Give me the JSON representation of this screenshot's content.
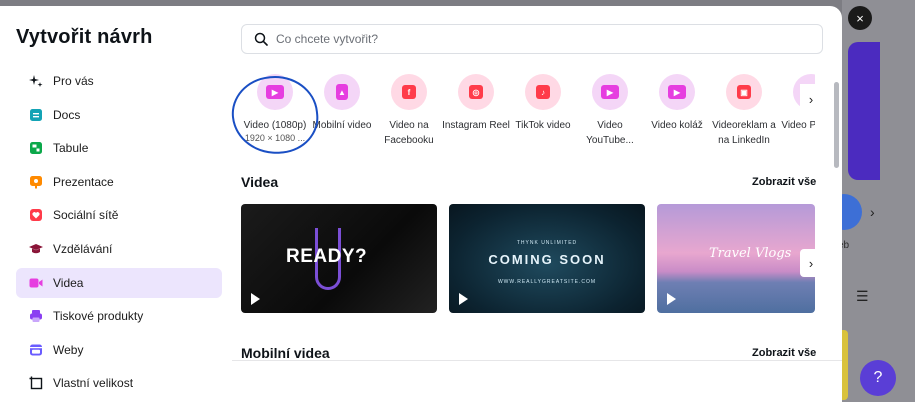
{
  "modal": {
    "title": "Vytvořit návrh",
    "close_label": "×",
    "help_label": "?"
  },
  "search": {
    "placeholder": "Co chcete vytvořit?"
  },
  "sidebar": {
    "items": [
      {
        "label": "Pro vás",
        "icon": "sparkle-icon",
        "color": "#0e1318"
      },
      {
        "label": "Docs",
        "icon": "docs-icon",
        "color": "#13a3b5"
      },
      {
        "label": "Tabule",
        "icon": "whiteboard-icon",
        "color": "#0ba84a"
      },
      {
        "label": "Prezentace",
        "icon": "presentation-icon",
        "color": "#ff8a00"
      },
      {
        "label": "Sociální sítě",
        "icon": "heart-icon",
        "color": "#ff3b4a"
      },
      {
        "label": "Vzdělávání",
        "icon": "graduation-cap-icon",
        "color": "#8a1538"
      },
      {
        "label": "Videa",
        "icon": "video-icon",
        "color": "#e63ee0",
        "active": true
      },
      {
        "label": "Tiskové produkty",
        "icon": "printer-icon",
        "color": "#8b3ff2"
      },
      {
        "label": "Weby",
        "icon": "website-icon",
        "color": "#6a5cff"
      },
      {
        "label": "Vlastní velikost",
        "icon": "custom-size-icon",
        "color": "#0e1318"
      }
    ]
  },
  "design_types": [
    {
      "label": "Video (1080p)",
      "sub": "1920 × 1080 ...",
      "icon": "video-play-icon",
      "color": "#e63ee0"
    },
    {
      "label": "Mobilní video",
      "sub": "",
      "icon": "mobile-video-icon",
      "color": "#e63ee0"
    },
    {
      "label": "Video na Facebooku",
      "sub": "",
      "icon": "facebook-icon",
      "color": "#ff3b4a"
    },
    {
      "label": "Instagram Reel",
      "sub": "",
      "icon": "instagram-icon",
      "color": "#ff3b4a"
    },
    {
      "label": "TikTok video",
      "sub": "",
      "icon": "tiktok-icon",
      "color": "#ff3b4a"
    },
    {
      "label": "Video YouTube...",
      "sub": "",
      "icon": "youtube-icon",
      "color": "#e63ee0"
    },
    {
      "label": "Video koláž",
      "sub": "",
      "icon": "video-collage-icon",
      "color": "#e63ee0"
    },
    {
      "label": "Videoreklam a na LinkedIn",
      "sub": "",
      "icon": "linkedin-icon",
      "color": "#ff3b4a"
    },
    {
      "label": "Video Pinte...",
      "sub": "",
      "icon": "pinterest-icon",
      "color": "#e63ee0"
    }
  ],
  "sections": {
    "videos": {
      "title": "Videa",
      "see_all": "Zobrazit vše"
    },
    "mobile_videos": {
      "title": "Mobilní videa",
      "see_all": "Zobrazit vše"
    }
  },
  "thumbnails": [
    {
      "text": "READY?"
    },
    {
      "text": "COMING SOON",
      "top_text": "THYNK UNLIMITED",
      "bottom_text": "WWW.REALLYGREATSITE.COM"
    },
    {
      "text": "Travel Vlogs"
    }
  ],
  "background": {
    "calendar_label": "eb"
  }
}
